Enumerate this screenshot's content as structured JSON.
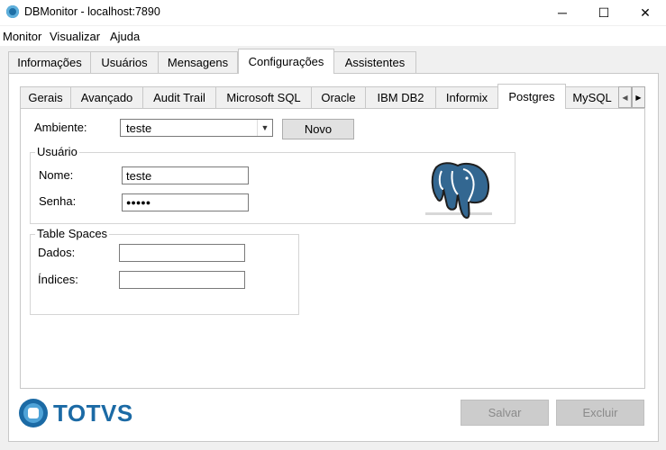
{
  "window": {
    "title": "DBMonitor - localhost:7890",
    "minimize": "─",
    "maximize": "☐",
    "close": "✕"
  },
  "menu": [
    "Monitor",
    "Visualizar",
    "Ajuda"
  ],
  "outer_tabs": [
    "Informações",
    "Usuários",
    "Mensagens",
    "Configurações",
    "Assistentes"
  ],
  "outer_active": "Configurações",
  "inner_tabs": [
    "Gerais",
    "Avançado",
    "Audit Trail",
    "Microsoft SQL",
    "Oracle",
    "IBM DB2",
    "Informix",
    "Postgres",
    "MySQL"
  ],
  "inner_active": "Postgres",
  "form": {
    "ambiente_label": "Ambiente:",
    "ambiente_value": "teste",
    "novo_button": "Novo",
    "usuario_group": "Usuário",
    "nome_label": "Nome:",
    "nome_value": "teste",
    "senha_label": "Senha:",
    "senha_value": "●●●●●",
    "tablespaces_group": "Table Spaces",
    "dados_label": "Dados:",
    "dados_value": "",
    "indices_label": "Índices:",
    "indices_value": ""
  },
  "footer": {
    "brand": "TOTVS",
    "salvar_button": "Salvar",
    "excluir_button": "Excluir"
  },
  "colors": {
    "brand_blue": "#1b6aa5",
    "postgres_blue": "#336791"
  }
}
